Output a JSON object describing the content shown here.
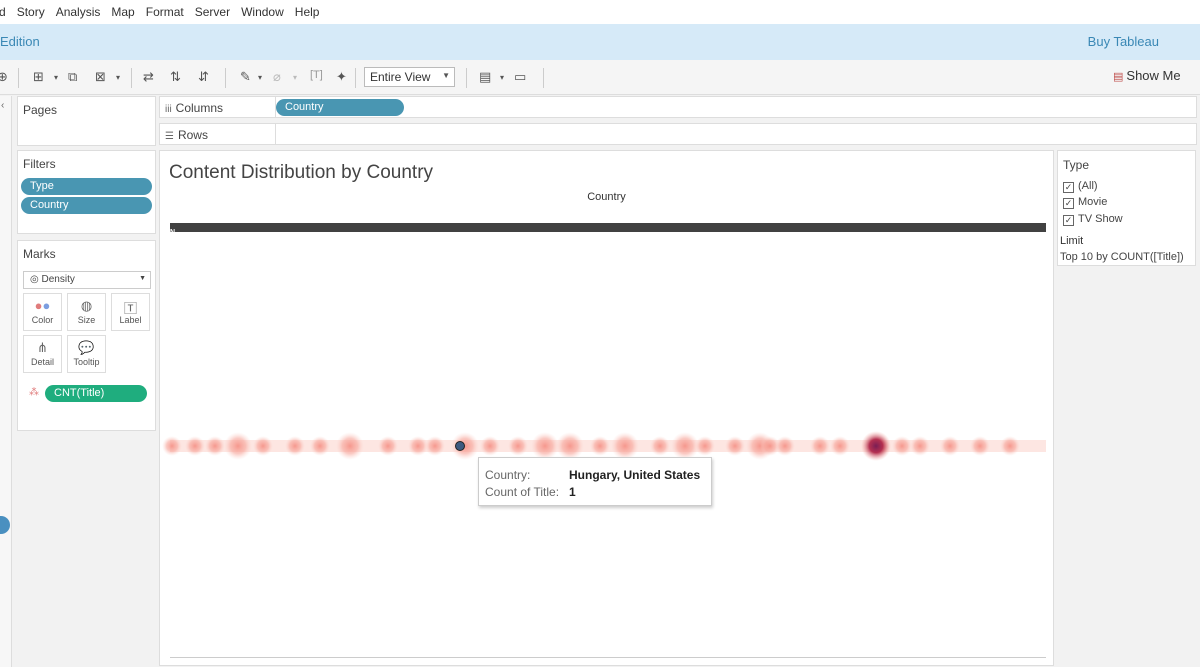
{
  "menu": [
    "d",
    "Story",
    "Analysis",
    "Map",
    "Format",
    "Server",
    "Window",
    "Help"
  ],
  "edition": {
    "label": "Edition",
    "buy": "Buy Tableau"
  },
  "toolbar": {
    "fit_value": "Entire View",
    "show_me": "Show Me"
  },
  "pages": {
    "title": "Pages"
  },
  "shelves": {
    "columns_label": "Columns",
    "columns_pill": "Country",
    "rows_label": "Rows"
  },
  "filters": {
    "title": "Filters",
    "items": [
      "Type",
      "Country"
    ]
  },
  "marks": {
    "title": "Marks",
    "type": "Density",
    "buttons": [
      "Color",
      "Size",
      "Label",
      "Detail",
      "Tooltip"
    ],
    "pill": "CNT(Title)"
  },
  "viz": {
    "title": "Content Distribution by Country",
    "axis_title": "Country",
    "header_text": "N"
  },
  "tooltip": {
    "country_key": "Country:",
    "country_value": "Hungary, United States",
    "count_key": "Count of Title:",
    "count_value": "1"
  },
  "type_filter": {
    "title": "Type",
    "options": [
      {
        "label": "(All)",
        "checked": true
      },
      {
        "label": "Movie",
        "checked": true
      },
      {
        "label": "TV Show",
        "checked": true
      }
    ],
    "limit_title": "Limit",
    "limit_value": "Top 10 by COUNT([Title])"
  },
  "colors": {
    "accent": "#4996b2",
    "measure": "#1fad7e",
    "density_low": "#f7a59a",
    "density_high": "#b0284a"
  }
}
